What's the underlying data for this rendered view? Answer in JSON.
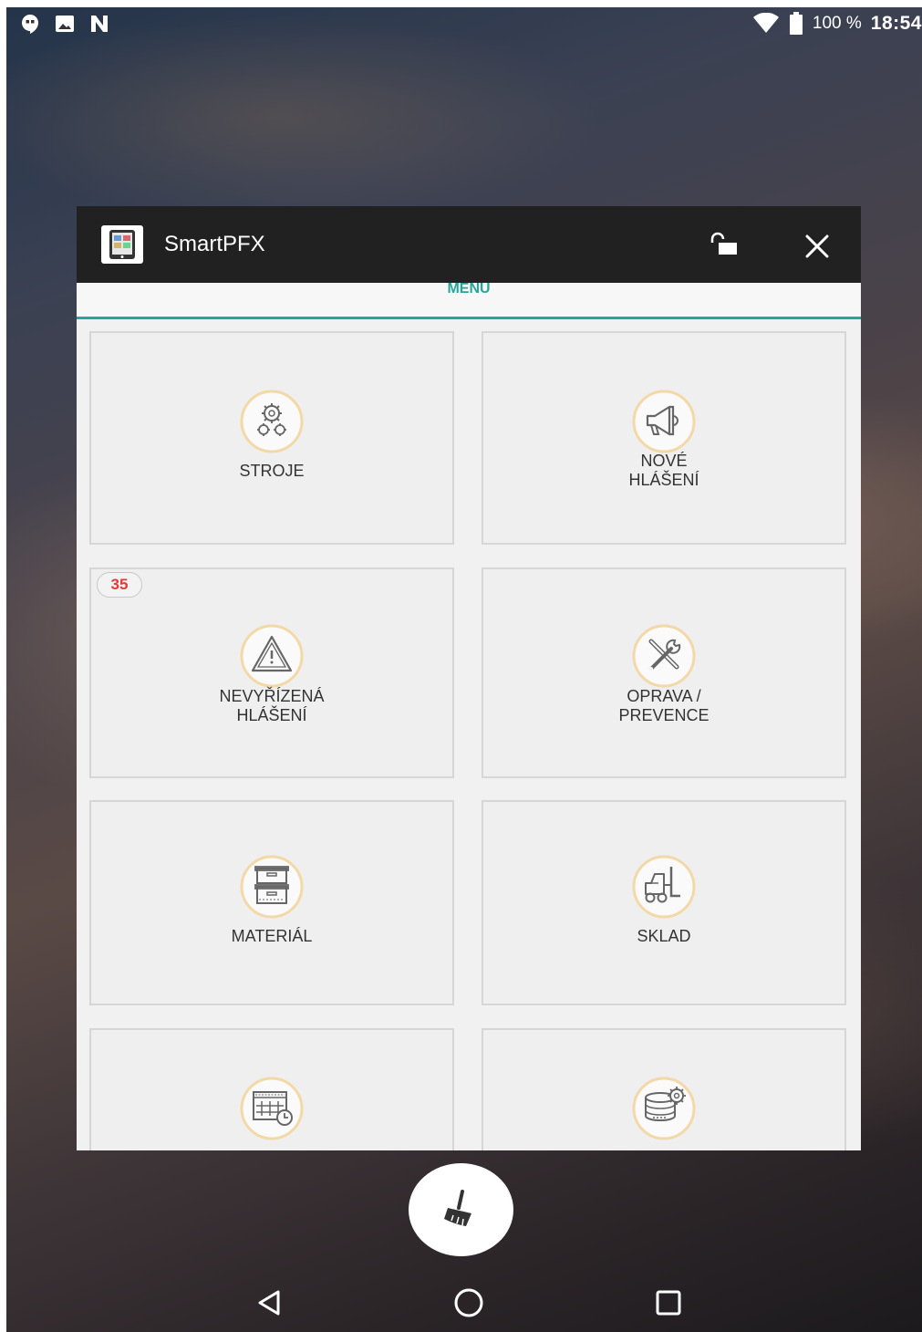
{
  "status_bar": {
    "left_icons": [
      "hangouts-icon",
      "image-icon",
      "n-icon"
    ],
    "battery_percent": "100 %",
    "time": "18:54"
  },
  "app": {
    "title": "SmartPFX",
    "menu_title": "MENU"
  },
  "tiles": [
    {
      "label": "STROJE",
      "icon": "gears-icon"
    },
    {
      "label": "NOVÉ\nHLÁŠENÍ",
      "icon": "megaphone-icon"
    },
    {
      "label": "NEVYŘÍZENÁ\nHLÁŠENÍ",
      "icon": "warning-icon",
      "badge": "35"
    },
    {
      "label": "OPRAVA /\nPREVENCE",
      "icon": "tools-icon"
    },
    {
      "label": "MATERIÁL",
      "icon": "boxes-icon"
    },
    {
      "label": "SKLAD",
      "icon": "forklift-icon"
    },
    {
      "label": "",
      "icon": "calendar-clock-icon"
    },
    {
      "label": "",
      "icon": "database-gear-icon"
    }
  ],
  "colors": {
    "accent": "#26a69a",
    "badge_text": "#e53935",
    "header_bg": "#212121",
    "icon_ring": "#f3d9a8"
  }
}
